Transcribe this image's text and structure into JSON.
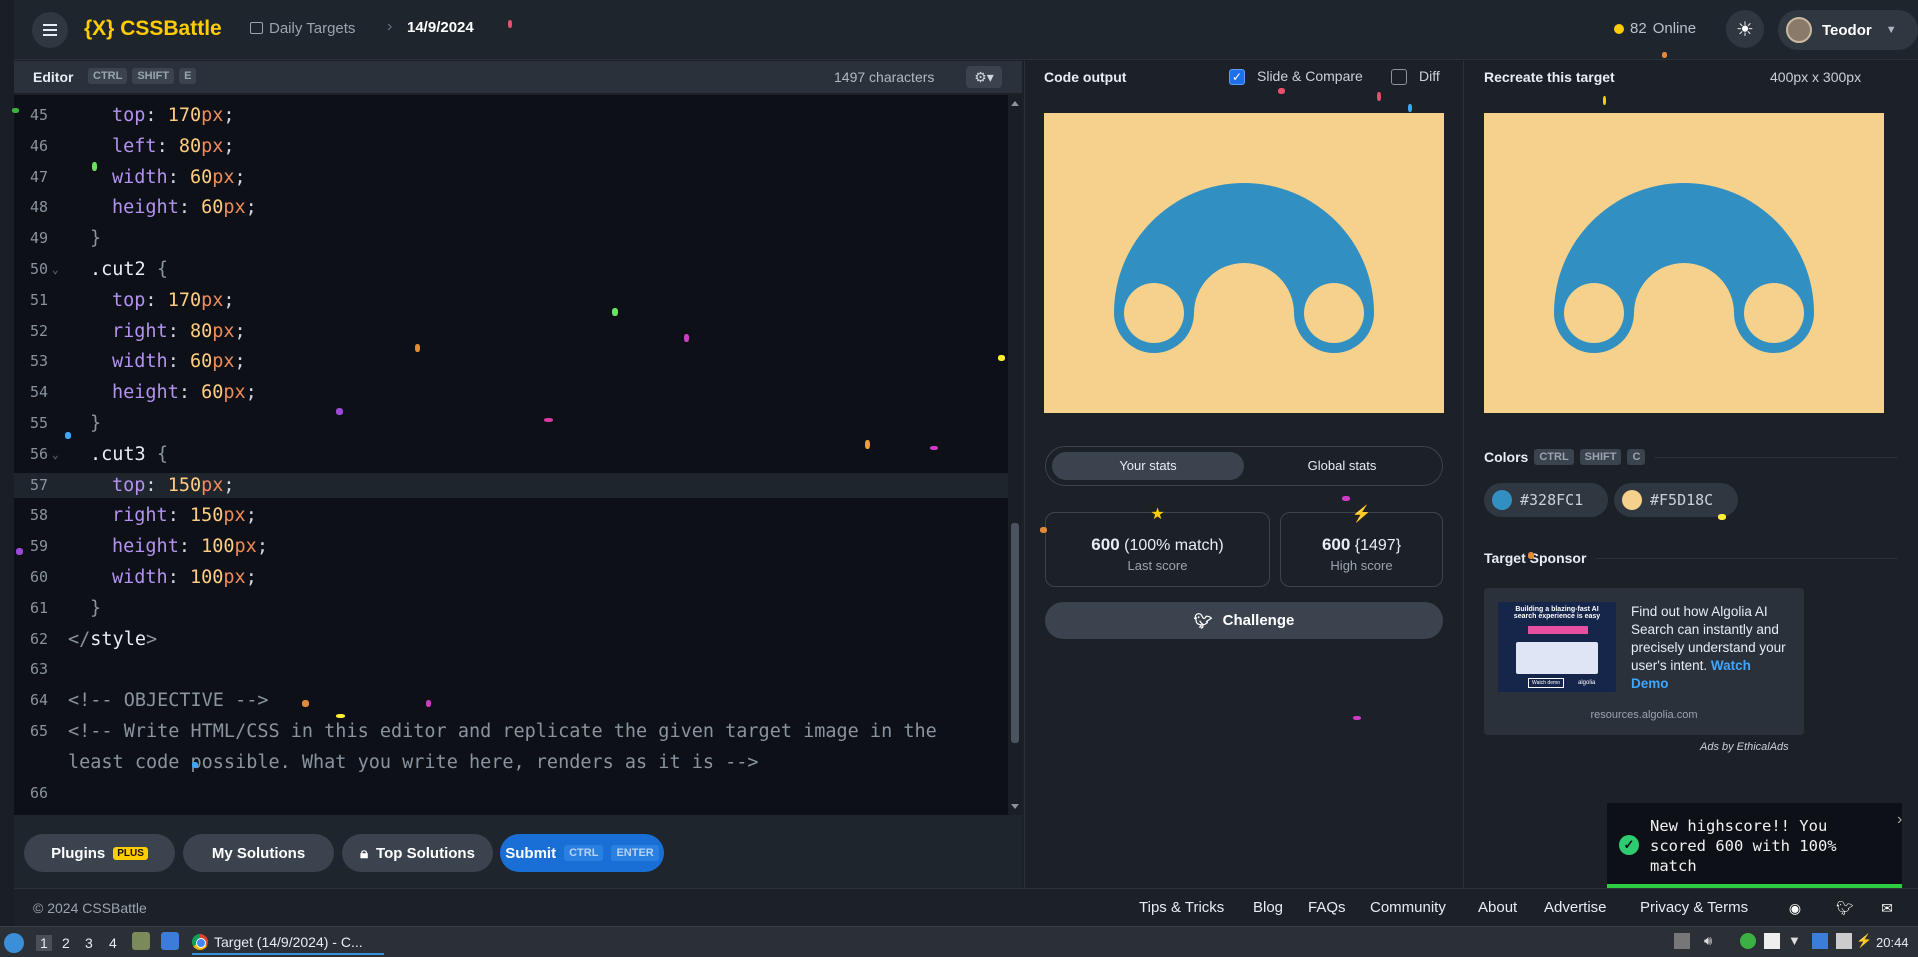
{
  "header": {
    "logo": "CSSBattle",
    "logo_mark": "{X}",
    "breadcrumb_parent": "Daily Targets",
    "breadcrumb_current": "14/9/2024",
    "online_count": "82",
    "online_label": "Online",
    "user_name": "Teodor"
  },
  "editor": {
    "title": "Editor",
    "shortcut": [
      "CTRL",
      "SHIFT",
      "E"
    ],
    "char_count": "1497 characters",
    "lines": [
      {
        "n": "45",
        "indent": 1,
        "kind": "decl",
        "prop": "top",
        "num": "170",
        "unit": "px"
      },
      {
        "n": "46",
        "indent": 1,
        "kind": "decl",
        "prop": "left",
        "num": "80",
        "unit": "px"
      },
      {
        "n": "47",
        "indent": 1,
        "kind": "decl",
        "prop": "width",
        "num": "60",
        "unit": "px"
      },
      {
        "n": "48",
        "indent": 1,
        "kind": "decl",
        "prop": "height",
        "num": "60",
        "unit": "px"
      },
      {
        "n": "49",
        "indent": 0,
        "kind": "close",
        "text": "}"
      },
      {
        "n": "50",
        "indent": 0,
        "kind": "rule",
        "text": ".cut2",
        "fold": true
      },
      {
        "n": "51",
        "indent": 1,
        "kind": "decl",
        "prop": "top",
        "num": "170",
        "unit": "px"
      },
      {
        "n": "52",
        "indent": 1,
        "kind": "decl",
        "prop": "right",
        "num": "80",
        "unit": "px"
      },
      {
        "n": "53",
        "indent": 1,
        "kind": "decl",
        "prop": "width",
        "num": "60",
        "unit": "px"
      },
      {
        "n": "54",
        "indent": 1,
        "kind": "decl",
        "prop": "height",
        "num": "60",
        "unit": "px"
      },
      {
        "n": "55",
        "indent": 0,
        "kind": "close",
        "text": "}"
      },
      {
        "n": "56",
        "indent": 0,
        "kind": "rule",
        "text": ".cut3",
        "fold": true
      },
      {
        "n": "57",
        "indent": 1,
        "kind": "decl",
        "prop": "top",
        "num": "150",
        "unit": "px",
        "active": true
      },
      {
        "n": "58",
        "indent": 1,
        "kind": "decl",
        "prop": "right",
        "num": "150",
        "unit": "px"
      },
      {
        "n": "59",
        "indent": 1,
        "kind": "decl",
        "prop": "height",
        "num": "100",
        "unit": "px"
      },
      {
        "n": "60",
        "indent": 1,
        "kind": "decl",
        "prop": "width",
        "num": "100",
        "unit": "px"
      },
      {
        "n": "61",
        "indent": 0,
        "kind": "close",
        "text": "}"
      },
      {
        "n": "62",
        "indent": -1,
        "kind": "tag",
        "text": "style"
      },
      {
        "n": "63",
        "indent": -1,
        "kind": "blank",
        "text": ""
      },
      {
        "n": "64",
        "indent": -1,
        "kind": "comment",
        "text": "<!-- OBJECTIVE -->"
      },
      {
        "n": "65",
        "indent": -1,
        "kind": "comment",
        "text": "<!-- Write HTML/CSS in this editor and replicate the given target image in the"
      },
      {
        "n": "",
        "indent": -1,
        "kind": "comment",
        "text": "least code possible. What you write here, renders as it is -->"
      },
      {
        "n": "66",
        "indent": -1,
        "kind": "blank",
        "text": ""
      }
    ],
    "buttons": {
      "plugins": "Plugins",
      "plugins_badge": "PLUS",
      "my_solutions": "My Solutions",
      "top_solutions": "Top Solutions",
      "submit": "Submit",
      "submit_keys": [
        "CTRL",
        "ENTER"
      ]
    }
  },
  "output": {
    "title": "Code output",
    "slide_compare": "Slide & Compare",
    "slide_compare_checked": true,
    "diff": "Diff",
    "diff_checked": false,
    "tabs": [
      "Your stats",
      "Global stats"
    ],
    "last_score_value": "600",
    "last_score_match": "(100% match)",
    "last_score_label": "Last score",
    "high_score_value": "600",
    "high_score_chars": "{1497}",
    "high_score_label": "High score",
    "challenge": "Challenge"
  },
  "target": {
    "title": "Recreate this target",
    "size": "400px x 300px",
    "colors_title": "Colors",
    "colors_shortcut": [
      "CTRL",
      "SHIFT",
      "C"
    ],
    "colors": [
      "#328FC1",
      "#F5D18C"
    ],
    "sponsor_title": "Target Sponsor",
    "sponsor_text": "Find out how Algolia AI Search can instantly and precisely understand your user's intent.",
    "sponsor_link": "Watch Demo",
    "sponsor_url": "resources.algolia.com",
    "ads_by": "Ads by EthicalAds",
    "ad_image_headline": "Building a blazing-fast AI search experience is easy",
    "ad_image_button": "Watch demo",
    "ad_image_brand": "algolia"
  },
  "toast": {
    "message": "New highscore!! You scored 600 with 100% match"
  },
  "footer": {
    "copyright": "© 2024 CSSBattle",
    "links": [
      "Tips & Tricks",
      "Blog",
      "FAQs",
      "Community",
      "About",
      "Advertise",
      "Privacy & Terms"
    ]
  },
  "taskbar": {
    "workspaces": [
      "1",
      "2",
      "3",
      "4"
    ],
    "task_title": "Target (14/9/2024) - C...",
    "clock": "20:44"
  },
  "colors": {
    "accent": "#FFCC00",
    "shape": "#328FC1",
    "background": "#F5D18C",
    "submit": "#1A6FD6"
  }
}
